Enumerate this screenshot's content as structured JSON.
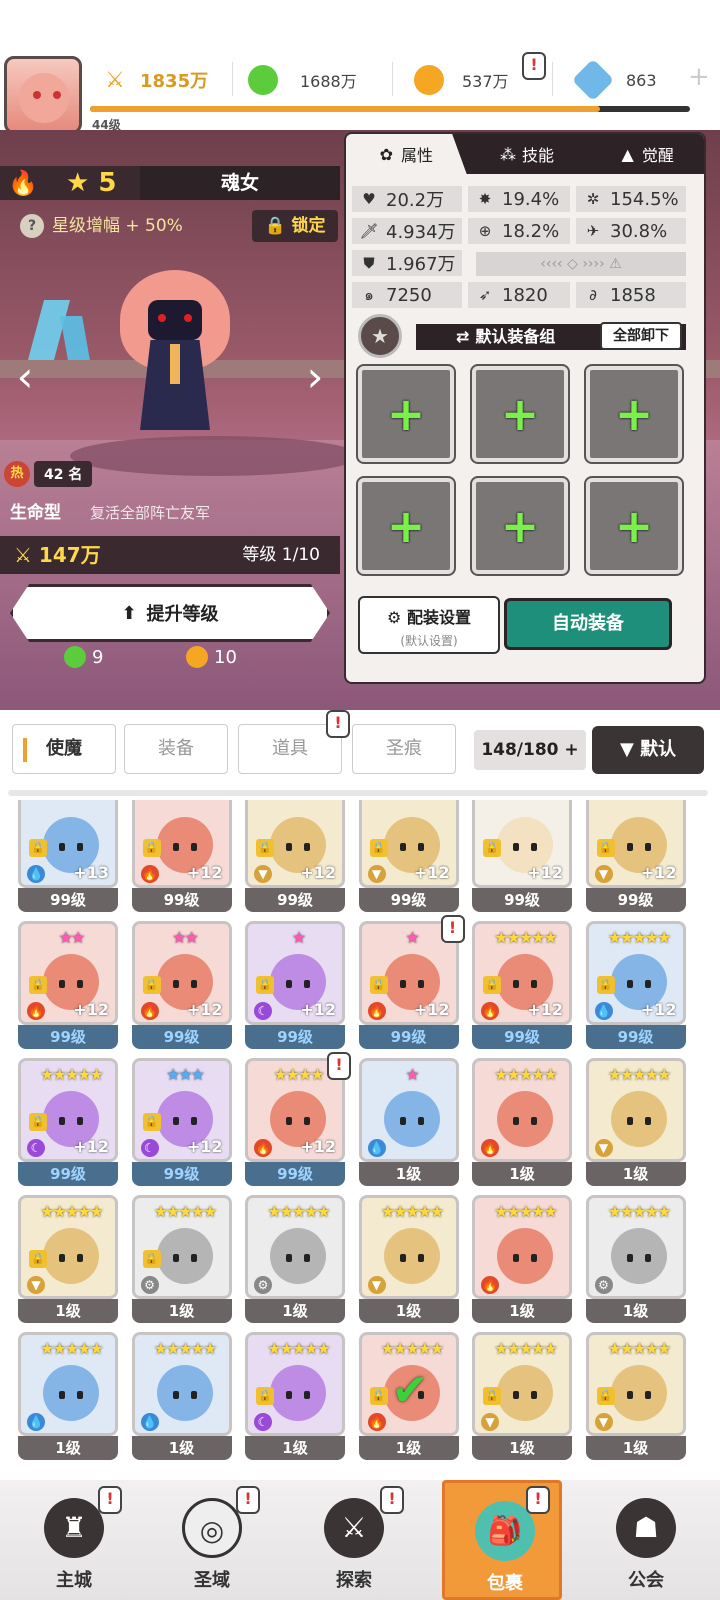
{
  "player": {
    "level": "44级"
  },
  "resources": [
    {
      "name": "power",
      "value": "1835万",
      "color": "#f0b030"
    },
    {
      "name": "green-gem",
      "value": "1688万",
      "color": "#5ccc3c"
    },
    {
      "name": "gold-coin",
      "value": "537万",
      "color": "#f5a623"
    },
    {
      "name": "crystal",
      "value": "863",
      "color": "#6fb8e8"
    }
  ],
  "xp_fraction": 0.85,
  "hero": {
    "stars": "5",
    "name": "魂女",
    "boost": "星级增幅 + 50%",
    "lock": "锁定",
    "hot": "热",
    "hot_rank": "42 名",
    "type": "生命型",
    "type_desc": "复活全部阵亡友军",
    "power": "147万",
    "level": "等级 1/10",
    "upgrade_label": "提升等级",
    "cost_green": "9",
    "cost_gold": "10"
  },
  "panel": {
    "tabs": [
      "属性",
      "技能",
      "觉醒"
    ],
    "stats": {
      "hp": "20.2万",
      "crit": "19.4%",
      "crit_dmg": "154.5%",
      "atk": "4.934万",
      "accuracy": "18.2%",
      "speed": "30.8%",
      "def": "1.967万",
      "s1": "7250",
      "s2": "1820",
      "s3": "1858"
    },
    "equip_group": "默认装备组",
    "unload_all": "全部卸下",
    "config": "配装设置",
    "config_sub": "(默认设置)",
    "auto_equip": "自动装备"
  },
  "inventory": {
    "tabs": [
      "使魔",
      "装备",
      "道具",
      "圣痕"
    ],
    "count": "148/180",
    "sort": "默认"
  },
  "cards": [
    {
      "lv": "99级",
      "plus": "+13",
      "el": "water",
      "stars": ""
    },
    {
      "lv": "99级",
      "plus": "+12",
      "el": "fire",
      "stars": ""
    },
    {
      "lv": "99级",
      "plus": "+12",
      "el": "earth",
      "stars": ""
    },
    {
      "lv": "99级",
      "plus": "+12",
      "el": "earth",
      "stars": ""
    },
    {
      "lv": "99级",
      "plus": "+12",
      "el": "",
      "stars": ""
    },
    {
      "lv": "99级",
      "plus": "+12",
      "el": "earth",
      "stars": ""
    },
    {
      "lv": "99级",
      "plus": "+12",
      "el": "fire",
      "stars": "★★"
    },
    {
      "lv": "99级",
      "plus": "+12",
      "el": "fire",
      "stars": "★★"
    },
    {
      "lv": "99级",
      "plus": "+12",
      "el": "dark",
      "stars": "★"
    },
    {
      "lv": "99级",
      "plus": "+12",
      "el": "fire",
      "stars": "★"
    },
    {
      "lv": "99级",
      "plus": "+12",
      "el": "fire",
      "stars": "★★★★★"
    },
    {
      "lv": "99级",
      "plus": "+12",
      "el": "water",
      "stars": "★★★★★"
    },
    {
      "lv": "99级",
      "plus": "+12",
      "el": "dark",
      "stars": "★★★★★"
    },
    {
      "lv": "99级",
      "plus": "+12",
      "el": "dark",
      "stars": "★★★"
    },
    {
      "lv": "99级",
      "plus": "+12",
      "el": "fire",
      "stars": "★★★★"
    },
    {
      "lv": "1级",
      "plus": "",
      "el": "water",
      "stars": "★"
    },
    {
      "lv": "1级",
      "plus": "",
      "el": "fire",
      "stars": "★★★★★"
    },
    {
      "lv": "1级",
      "plus": "",
      "el": "earth",
      "stars": "★★★★★"
    },
    {
      "lv": "1级",
      "plus": "",
      "el": "earth",
      "stars": "★★★★★"
    },
    {
      "lv": "1级",
      "plus": "",
      "el": "gear",
      "stars": "★★★★★"
    },
    {
      "lv": "1级",
      "plus": "",
      "el": "gear",
      "stars": "★★★★★"
    },
    {
      "lv": "1级",
      "plus": "",
      "el": "earth",
      "stars": "★★★★★"
    },
    {
      "lv": "1级",
      "plus": "",
      "el": "fire",
      "stars": "★★★★★"
    },
    {
      "lv": "1级",
      "plus": "",
      "el": "gear",
      "stars": "★★★★★"
    },
    {
      "lv": "1级",
      "plus": "",
      "el": "water",
      "stars": "★★★★★"
    },
    {
      "lv": "1级",
      "plus": "",
      "el": "water",
      "stars": "★★★★★"
    },
    {
      "lv": "1级",
      "plus": "",
      "el": "dark",
      "stars": "★★★★★"
    },
    {
      "lv": "1级",
      "plus": "",
      "el": "fire",
      "stars": "★★★★★"
    },
    {
      "lv": "1级",
      "plus": "",
      "el": "earth",
      "stars": "★★★★★"
    },
    {
      "lv": "1级",
      "plus": "",
      "el": "earth",
      "stars": "★★★★★"
    }
  ],
  "nav": [
    {
      "label": "主城",
      "icon": "castle-icon"
    },
    {
      "label": "圣域",
      "icon": "portal-icon"
    },
    {
      "label": "探索",
      "icon": "sword-icon"
    },
    {
      "label": "包裹",
      "icon": "bag-icon"
    },
    {
      "label": "公会",
      "icon": "guild-icon"
    }
  ]
}
